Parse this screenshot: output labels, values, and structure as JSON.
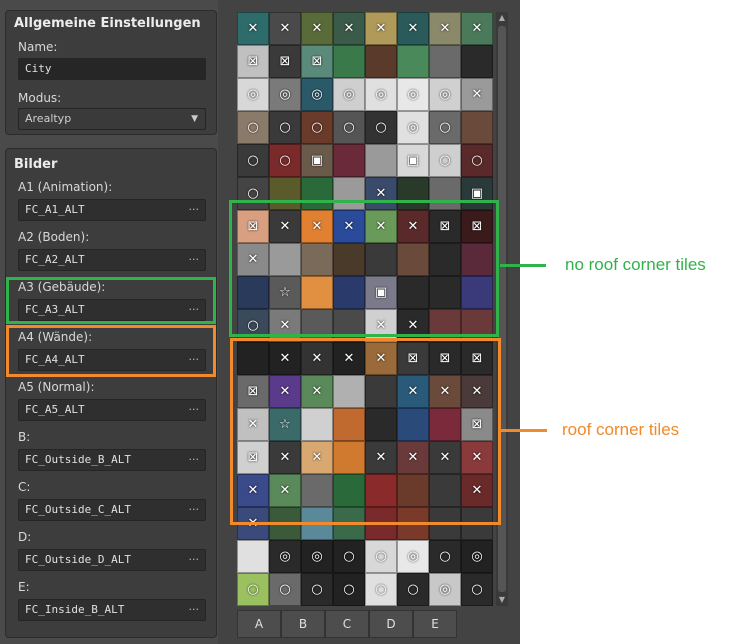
{
  "general": {
    "title": "Allgemeine Einstellungen",
    "name_label": "Name:",
    "name_value": "City",
    "mode_label": "Modus:",
    "mode_value": "Arealtyp"
  },
  "images": {
    "title": "Bilder",
    "browse": "···",
    "fields": [
      {
        "label": "A1 (Animation):",
        "value": "FC_A1_ALT"
      },
      {
        "label": "A2 (Boden):",
        "value": "FC_A2_ALT"
      },
      {
        "label": "A3 (Gebäude):",
        "value": "FC_A3_ALT"
      },
      {
        "label": "A4 (Wände):",
        "value": "FC_A4_ALT"
      },
      {
        "label": "A5 (Normal):",
        "value": "FC_A5_ALT"
      },
      {
        "label": "B:",
        "value": "FC_Outside_B_ALT"
      },
      {
        "label": "C:",
        "value": "FC_Outside_C_ALT"
      },
      {
        "label": "D:",
        "value": "FC_Outside_D_ALT"
      },
      {
        "label": "E:",
        "value": "FC_Inside_B_ALT"
      }
    ]
  },
  "tabs": [
    "A",
    "B",
    "C",
    "D",
    "E"
  ],
  "annotations": {
    "green_label": "no roof corner tiles",
    "orange_label": "roof corner tiles",
    "green_color": "#2fb34a",
    "orange_color": "#f08a2c"
  },
  "tiles": {
    "colors": [
      "#2e6b6b",
      "#4a4a4a",
      "#5a6b3a",
      "#3a5a4a",
      "#b09a5a",
      "#2a5a5a",
      "#8a8a6a",
      "#4a7a5a",
      "#c0c0c0",
      "#3a3a3a",
      "#5a8a7a",
      "#3a7a4a",
      "#5a3a2a",
      "#4a8a5a",
      "#6a6a6a",
      "#2a2a2a",
      "#d8d8d8",
      "#7a7a7a",
      "#2a5a6a",
      "#cfcfcf",
      "#e0e0e0",
      "#e8e8e8",
      "#d0d0d0",
      "#9a9a9a",
      "#8a7a6a",
      "#3a3a3a",
      "#6a3a2a",
      "#555555",
      "#333333",
      "#e0e0e0",
      "#6a6a6a",
      "#6a4a3a",
      "#3a3a3a",
      "#7a2a2a",
      "#6a5a4a",
      "#6a2a3a",
      "#9a9a9a",
      "#d8d8d8",
      "#cfcfcf",
      "#5a2a2a",
      "#444444",
      "#5a5a2a",
      "#2a6a3a",
      "#9a9a9a",
      "#3a4a6a",
      "#2a3a2a",
      "#6a6a6a",
      "#2a3a3a",
      "#d8a080",
      "#3a3a3a",
      "#e08030",
      "#2a4a9a",
      "#6a9a5a",
      "#5a2a2a",
      "#2a2a2a",
      "#3a1a1a",
      "#8a8a8a",
      "#9a9a9a",
      "#7a6a5a",
      "#4a3a2a",
      "#3a3a3a",
      "#6a4a3a",
      "#2a2a2a",
      "#5a2a3a",
      "#2a3a5a",
      "#5a5a5a",
      "#e09040",
      "#2a3a6a",
      "#7a7a8a",
      "#2a2a2a",
      "#2a2a2a",
      "#3a3a7a",
      "#3a4a5a",
      "#7a7a7a",
      "#5a5a5a",
      "#4a4a4a",
      "#d0d0d0",
      "#2a2a2a",
      "#6a3a3a",
      "#6a3a3a",
      "#222222",
      "#222222",
      "#333333",
      "#222222",
      "#9a6a3a",
      "#3a3a3a",
      "#2a2a2a",
      "#2a2a2a",
      "#6a6a6a",
      "#5a3a8a",
      "#5a8a5a",
      "#b0b0b0",
      "#3a3a3a",
      "#2a5a7a",
      "#6a4a3a",
      "#4a3a3a",
      "#c0c0c0",
      "#3a6a6a",
      "#d0d0d0",
      "#c06a30",
      "#2a2a2a",
      "#2a4a7a",
      "#7a2a3a",
      "#8a8a8a",
      "#d0d0d0",
      "#3a3a3a",
      "#d8a870",
      "#d07a30",
      "#3a3a3a",
      "#6a3a3a",
      "#3a3a3a",
      "#8a3a3a",
      "#3a4a8a",
      "#5a8a5a",
      "#6a6a6a",
      "#2a6a3a",
      "#8a2a2a",
      "#6a3a2a",
      "#3a3a3a",
      "#6a2a2a",
      "#3a4a7a",
      "#3a5a3a",
      "#5a8a9a",
      "#3a6a4a",
      "#7a2a2a",
      "#7a3a2a",
      "#3a3a3a",
      "#3a3a3a",
      "#e0e0e0",
      "#2a2a2a",
      "#222222",
      "#222222",
      "#d8d8d8",
      "#e8e8e8",
      "#2a2a2a",
      "#222222",
      "#9ac060",
      "#6a6a6a",
      "#2a2a2a",
      "#222222",
      "#e0e0e0",
      "#2a2a2a",
      "#c8c8c8",
      "#2a2a2a"
    ],
    "glyphs": [
      "✕",
      "✕",
      "✕",
      "✕",
      "✕",
      "✕",
      "✕",
      "✕",
      "⊠",
      "⊠",
      "⊠",
      "",
      "",
      "",
      "",
      "",
      "◎",
      "◎",
      "◎",
      "◎",
      "◎",
      "◎",
      "◎",
      "✕",
      "○",
      "○",
      "○",
      "○",
      "○",
      "◎",
      "○",
      "",
      "○",
      "○",
      "▣",
      "",
      "",
      "▣",
      "○",
      "○",
      "○",
      "",
      "",
      "",
      "✕",
      "",
      "",
      "▣",
      "⊠",
      "✕",
      "✕",
      "✕",
      "✕",
      "✕",
      "⊠",
      "⊠",
      "✕",
      "",
      "",
      "",
      "",
      "",
      "",
      "",
      "",
      "☆",
      "",
      "",
      "▣",
      "",
      "",
      "",
      "○",
      "✕",
      "",
      "",
      "✕",
      "✕",
      "",
      "",
      "",
      "✕",
      "✕",
      "✕",
      "✕",
      "⊠",
      "⊠",
      "⊠",
      "⊠",
      "✕",
      "✕",
      "",
      "",
      "✕",
      "✕",
      "✕",
      "✕",
      "☆",
      "",
      "",
      "",
      "",
      "",
      "⊠",
      "⊠",
      "✕",
      "✕",
      "",
      "✕",
      "✕",
      "✕",
      "✕",
      "✕",
      "✕",
      "",
      "",
      "",
      "",
      "",
      "✕",
      "✕",
      "",
      "",
      "",
      "",
      "",
      "",
      "",
      "",
      "◎",
      "◎",
      "○",
      "○",
      "◎",
      "○",
      "◎",
      "○",
      "○",
      "○",
      "○",
      "○",
      "○",
      "◎",
      "○",
      "○"
    ]
  }
}
